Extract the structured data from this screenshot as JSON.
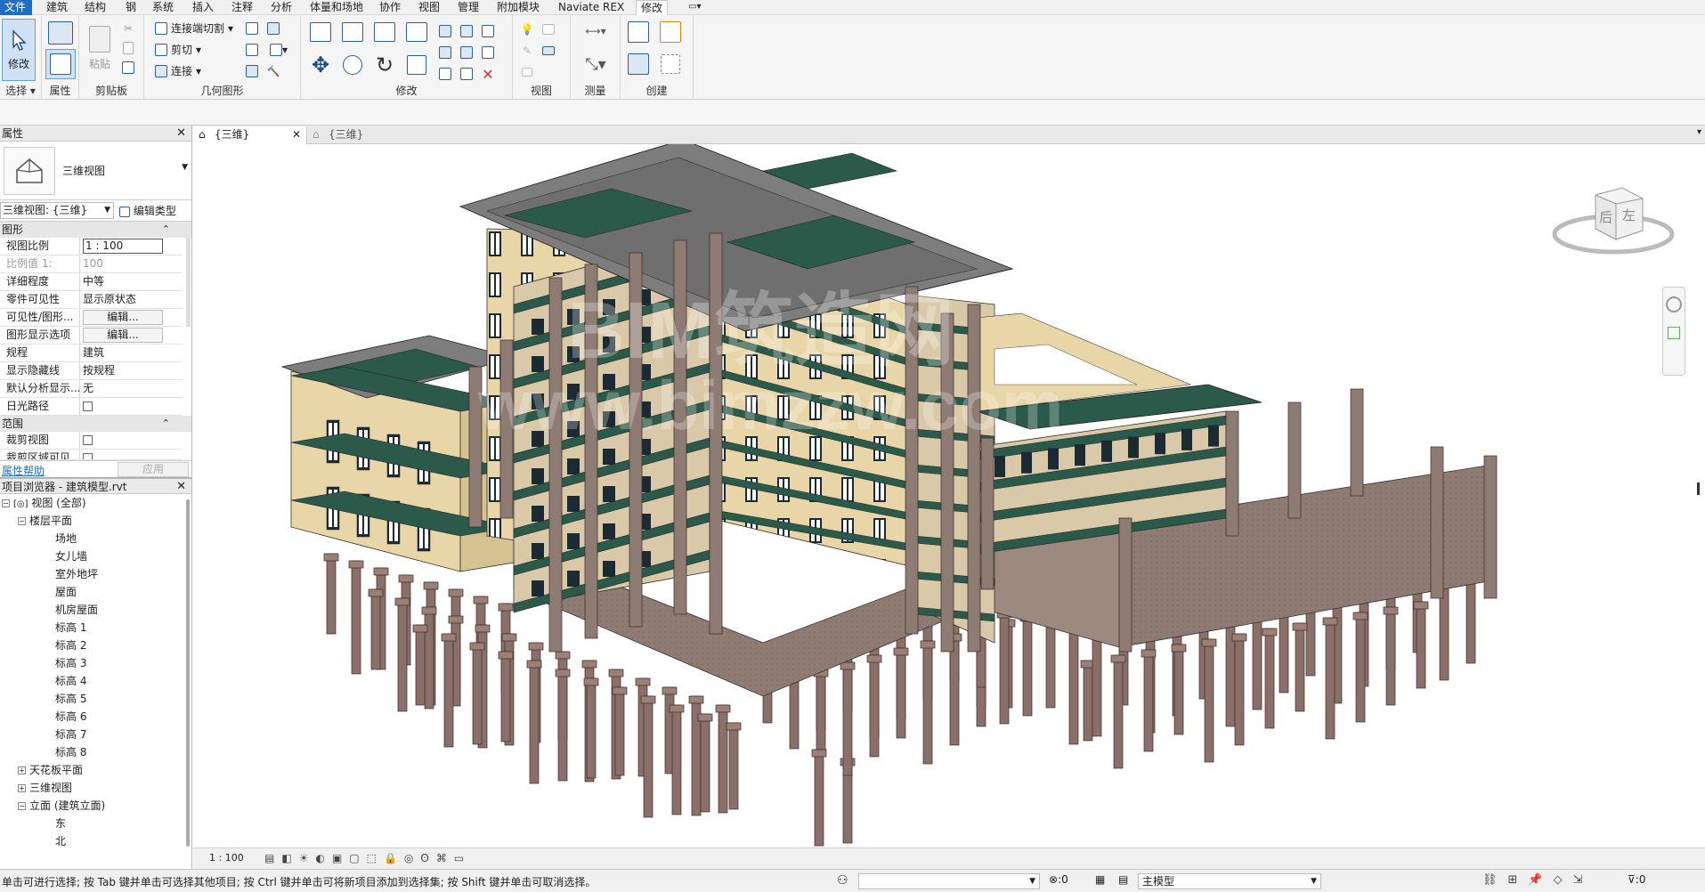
{
  "menu": {
    "tabs": [
      "文件",
      "建筑",
      "结构",
      "钢",
      "系统",
      "插入",
      "注释",
      "分析",
      "体量和场地",
      "协作",
      "视图",
      "管理",
      "附加模块",
      "Naviate REX",
      "修改"
    ],
    "active_tab": "修改"
  },
  "ribbon": {
    "select": {
      "modify_label": "修改",
      "panel_label": "选择"
    },
    "properties": {
      "panel_label": "属性"
    },
    "clipboard": {
      "paste_label": "粘贴",
      "panel_label": "剪贴板"
    },
    "geometry": {
      "cut_connect_label": "连接端切割",
      "cut_label": "剪切",
      "join_label": "连接",
      "panel_label": "几何图形"
    },
    "modify": {
      "panel_label": "修改"
    },
    "view": {
      "panel_label": "视图"
    },
    "measure": {
      "panel_label": "测量"
    },
    "create": {
      "panel_label": "创建"
    }
  },
  "properties_panel": {
    "title": "属性",
    "type_name": "三维视图",
    "view_selector": "三维视图: {三维}",
    "edit_type_label": "编辑类型",
    "sections": {
      "graphics": "图形",
      "extents": "范围"
    },
    "rows": [
      {
        "key": "视图比例",
        "value": "1 : 100"
      },
      {
        "key": "比例值 1:",
        "value": "100"
      },
      {
        "key": "详细程度",
        "value": "中等"
      },
      {
        "key": "零件可见性",
        "value": "显示原状态"
      },
      {
        "key": "可见性/图形...",
        "value": "编辑..."
      },
      {
        "key": "图形显示选项",
        "value": "编辑..."
      },
      {
        "key": "规程",
        "value": "建筑"
      },
      {
        "key": "显示隐藏线",
        "value": "按规程"
      },
      {
        "key": "默认分析显示...",
        "value": "无"
      },
      {
        "key": "日光路径",
        "value": ""
      }
    ],
    "extent_rows": [
      {
        "key": "裁剪视图",
        "value": ""
      },
      {
        "key": "裁剪区域可见",
        "value": ""
      }
    ],
    "help_link": "属性帮助",
    "apply_label": "应用"
  },
  "project_browser": {
    "title": "项目浏览器 - 建筑模型.rvt",
    "root": "视图 (全部)",
    "floor_plans": "楼层平面",
    "floor_plan_items": [
      "场地",
      "女儿墙",
      "室外地坪",
      "屋面",
      "机房屋面",
      "标高 1",
      "标高 2",
      "标高 3",
      "标高 4",
      "标高 5",
      "标高 6",
      "标高 7",
      "标高 8"
    ],
    "ceiling_plans": "天花板平面",
    "views_3d": "三维视图",
    "elevations": "立面 (建筑立面)",
    "elevation_items": [
      "东",
      "北"
    ]
  },
  "doc_tabs": [
    {
      "label": "{三维}",
      "active": true
    },
    {
      "label": "{三维}",
      "active": false
    }
  ],
  "viewcube": {
    "face_back": "后",
    "face_left": "左"
  },
  "watermark": {
    "line1": "BIM筑造网",
    "line2": "www.bimzzw.com"
  },
  "view_bar": {
    "scale": "1 : 100"
  },
  "status_bar": {
    "message": "单击可进行选择; 按 Tab 键并单击可选择其他项目; 按 Ctrl 键并单击可将新项目添加到选择集; 按 Shift 键并单击可取消选择。",
    "selection_count": ":0",
    "model_label": "主模型",
    "filter_count": ":0"
  },
  "colors": {
    "accent": "#1e6fc3",
    "building_wall": "#e9d6a8",
    "building_concrete": "#8e7b73",
    "building_floor": "#2b5a4a",
    "building_roof": "#7d7d7d"
  }
}
